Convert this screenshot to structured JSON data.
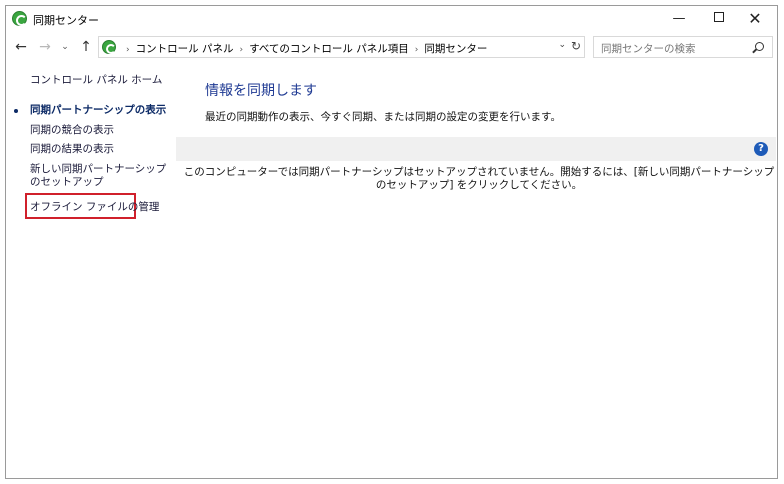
{
  "window": {
    "title": "同期センター",
    "minimize_glyph": "—",
    "close_glyph": "✕"
  },
  "nav": {
    "back_glyph": "←",
    "forward_glyph": "→",
    "recent_glyph": "⌄",
    "up_glyph": "↑",
    "breadcrumbs": [
      "コントロール パネル",
      "すべてのコントロール パネル項目",
      "同期センター"
    ],
    "crumb_sep": "›",
    "dropdown_glyph": "⌄",
    "refresh_glyph": "↻"
  },
  "search": {
    "placeholder": "同期センターの検索"
  },
  "sidebar": {
    "home": "コントロール パネル ホーム",
    "items": [
      {
        "label": "同期パートナーシップの表示",
        "selected": true
      },
      {
        "label": "同期の競合の表示"
      },
      {
        "label": "同期の結果の表示"
      },
      {
        "label": "新しい同期パートナーシップのセットアップ"
      },
      {
        "label": "オフライン ファイルの管理"
      }
    ]
  },
  "main": {
    "title": "情報を同期します",
    "description": "最近の同期動作の表示、今すぐ同期、または同期の設定の変更を行います。",
    "help_glyph": "?",
    "empty_message": "このコンピューターでは同期パートナーシップはセットアップされていません。開始するには、[新しい同期パートナーシップのセットアップ] をクリックしてください。"
  },
  "colors": {
    "accent_title": "#1f3a93",
    "highlight": "#d0202b",
    "sync_icon": "#3aa640"
  }
}
